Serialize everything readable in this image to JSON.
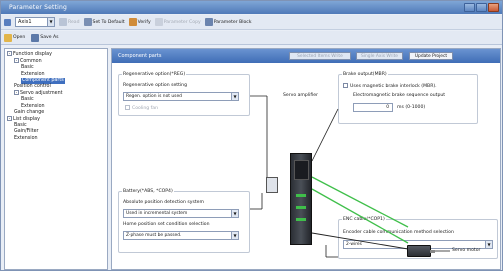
{
  "window": {
    "title": "Parameter Setting"
  },
  "toolbar": {
    "axis_value": "Axis1",
    "read_label": "Read",
    "set_default_label": "Set To Default",
    "verify_label": "Verify",
    "param_copy_label": "Parameter Copy",
    "param_block_label": "Parameter Block",
    "open_label": "Open",
    "save_as_label": "Save As"
  },
  "tree": {
    "items": [
      {
        "label": "Function display",
        "level": 0,
        "expander": "-"
      },
      {
        "label": "Common",
        "level": 1,
        "expander": "-"
      },
      {
        "label": "Basic",
        "level": 2
      },
      {
        "label": "Extension",
        "level": 2
      },
      {
        "label": "Component parts",
        "level": 2,
        "selected": true
      },
      {
        "label": "Position control",
        "level": 1
      },
      {
        "label": "Servo adjustment",
        "level": 1,
        "expander": "-"
      },
      {
        "label": "Basic",
        "level": 2
      },
      {
        "label": "Extension",
        "level": 2
      },
      {
        "label": "Gain change",
        "level": 1
      },
      {
        "label": "List display",
        "level": 0,
        "expander": "-"
      },
      {
        "label": "Basic",
        "level": 1
      },
      {
        "label": "Gain/Filter",
        "level": 1
      },
      {
        "label": "Extension",
        "level": 1
      }
    ]
  },
  "main": {
    "header_title": "Component parts",
    "selected_items_write": "Selected Items Write",
    "single_axis_write": "Single Axis Write",
    "update_project": "Update Project",
    "regen": {
      "group_label": "Regenerative option(*REG)",
      "setting_label": "Regenerative option setting",
      "setting_value": "Regen. option is not used",
      "cooling_fan": "Cooling fan"
    },
    "servo_amplifier": "Servo amplifier",
    "brake": {
      "group_label": "Brake output(MBR)",
      "interlock_label": "Uses magnetic brake interlock (MBR).",
      "sequence_label": "Electromagnetic brake sequence output",
      "sequence_value": "0",
      "sequence_unit": "ms (0-1000)"
    },
    "battery": {
      "group_label": "Battery(*ABS, *COP4)",
      "abs_label": "Absolute position detection system",
      "abs_value": "Used in incremental system",
      "home_label": "Home position set condition selection",
      "home_value": "Z-phase must be passed."
    },
    "servo_motor": "Servo motor",
    "enc": {
      "group_label": "ENC cable(*COP1)",
      "method_label": "Encoder cable communication method selection",
      "method_value": "2-wires"
    }
  },
  "colors": {
    "header": "#4f7cc2",
    "selection": "#3f6fbf",
    "cable": "#3fbf4a"
  }
}
